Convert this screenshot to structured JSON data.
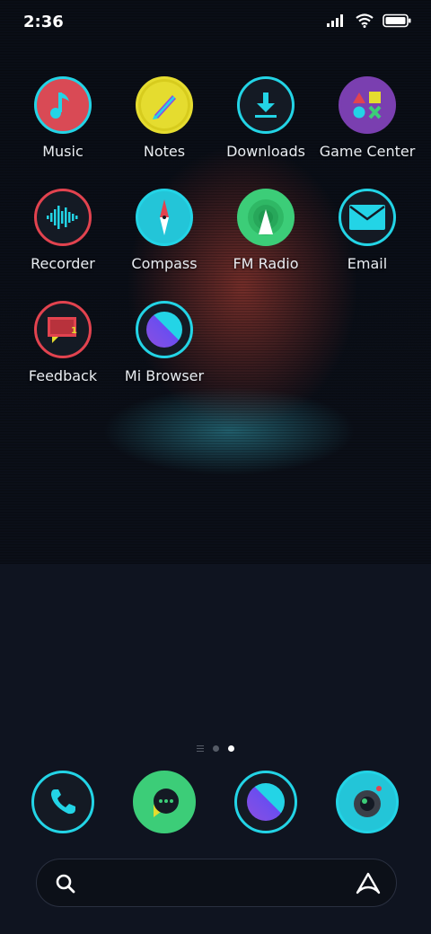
{
  "status": {
    "time": "2:36"
  },
  "apps": [
    {
      "label": "Music"
    },
    {
      "label": "Notes"
    },
    {
      "label": "Downloads"
    },
    {
      "label": "Game Center"
    },
    {
      "label": "Recorder"
    },
    {
      "label": "Compass"
    },
    {
      "label": "FM Radio"
    },
    {
      "label": "Email"
    },
    {
      "label": "Feedback",
      "badge": "1"
    },
    {
      "label": "Mi Browser"
    }
  ],
  "page_indicator": {
    "pages": 2,
    "current": 2
  },
  "dock": [
    {
      "icon": "phone-icon"
    },
    {
      "icon": "messages-icon"
    },
    {
      "icon": "browser-icon"
    },
    {
      "icon": "camera-icon"
    }
  ],
  "colors": {
    "accent": "#23d4e6",
    "background": "#0f1420"
  }
}
